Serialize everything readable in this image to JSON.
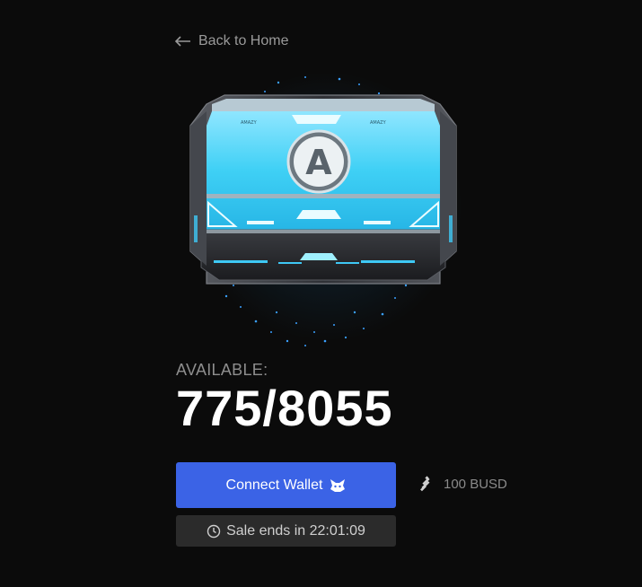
{
  "nav": {
    "back_label": "Back to Home"
  },
  "chest": {
    "brand_letter": "A",
    "tag_left": "AMAZY",
    "tag_right": "AMAZY"
  },
  "availability": {
    "label": "AVAILABLE:",
    "count": "775/8055"
  },
  "actions": {
    "connect_wallet_label": "Connect Wallet"
  },
  "price": {
    "label": "100 BUSD"
  },
  "sale": {
    "text": "Sale ends in 22:01:09"
  },
  "icons": {
    "back": "arrow-left-icon",
    "wallet": "fox-icon",
    "currency": "busd-icon",
    "timer": "clock-icon"
  },
  "colors": {
    "background": "#0b0b0b",
    "accent": "#3b63e6",
    "chest_glow": "#37c8f2",
    "muted_text": "#9a9a9a"
  }
}
